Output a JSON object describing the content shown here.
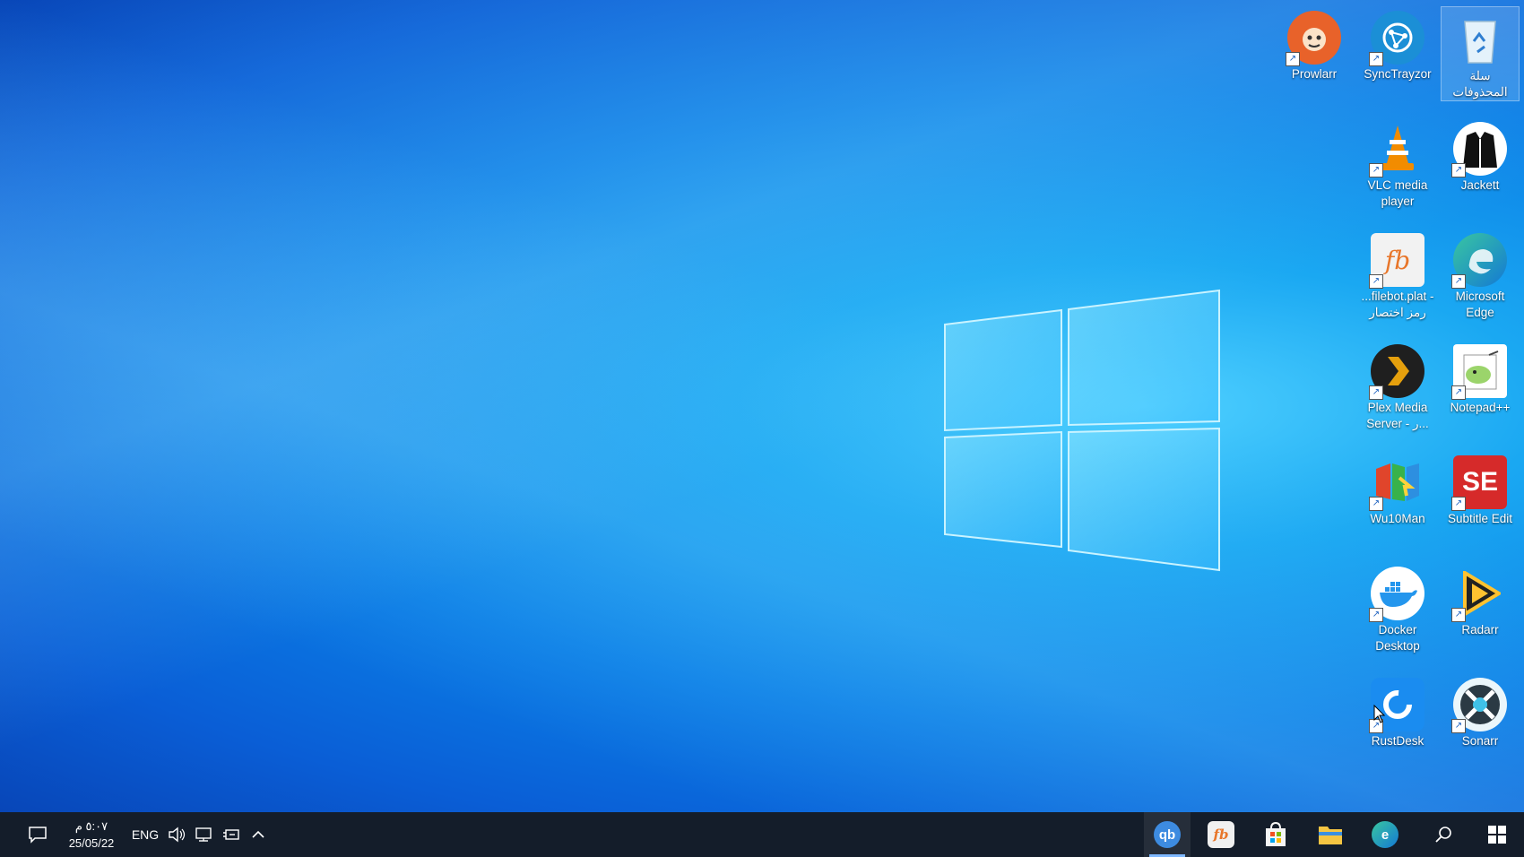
{
  "desktop": {
    "icons": [
      {
        "label": "Prowlarr",
        "icon": "prowlarr-icon",
        "color": "#e8622a"
      },
      {
        "label": "SyncTrayzor",
        "icon": "synctrayzor-icon",
        "color": "#1b8fd6"
      },
      {
        "label": "سلة المحذوفات",
        "icon": "recycle-bin-icon",
        "color": "#d9edf7"
      },
      {
        "label": "VLC media player",
        "icon": "vlc-icon",
        "color": "#f28c00"
      },
      {
        "label": "Jackett",
        "icon": "jackett-icon",
        "color": "#111111"
      },
      {
        "label": "...filebot.plat - رمز اختصار",
        "icon": "filebot-icon",
        "color": "#f2f2f2"
      },
      {
        "label": "Microsoft Edge",
        "icon": "edge-icon",
        "color": "#2fb38a"
      },
      {
        "label": "Plex Media Server - ر...",
        "icon": "plex-icon",
        "color": "#1f1f1f"
      },
      {
        "label": "Notepad++",
        "icon": "notepadpp-icon",
        "color": "#9bd46b"
      },
      {
        "label": "Wu10Man",
        "icon": "wu10man-icon",
        "color": "#e0452b"
      },
      {
        "label": "Subtitle Edit",
        "icon": "subtitle-edit-icon",
        "color": "#d62a2a"
      },
      {
        "label": "Docker Desktop",
        "icon": "docker-icon",
        "color": "#2496ed"
      },
      {
        "label": "Radarr",
        "icon": "radarr-icon",
        "color": "#ffc230"
      },
      {
        "label": "RustDesk",
        "icon": "rustdesk-icon",
        "color": "#1a8cf0"
      },
      {
        "label": "Sonarr",
        "icon": "sonarr-icon",
        "color": "#3fc1e8"
      }
    ]
  },
  "taskbar": {
    "time": "٥:٠٧ م",
    "date": "25/05/22",
    "language": "ENG",
    "apps": [
      {
        "name": "qBittorrent",
        "glyph": "qb",
        "color": "#3d8be0"
      },
      {
        "name": "FileBot",
        "glyph": "fb",
        "color": "#f0f0f0"
      },
      {
        "name": "Microsoft Store",
        "glyph": "▦",
        "color": "#f5f5f5"
      },
      {
        "name": "File Explorer",
        "glyph": "▬",
        "color": "#f5c542"
      },
      {
        "name": "Microsoft Edge",
        "glyph": "e",
        "color": "#2fb38a"
      }
    ]
  }
}
